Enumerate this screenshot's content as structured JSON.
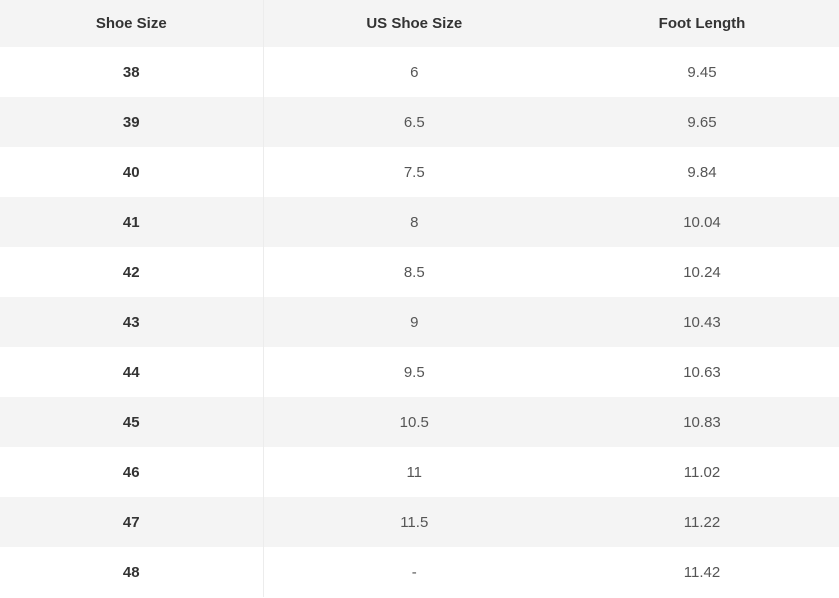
{
  "table": {
    "headers": [
      "Shoe Size",
      "US Shoe Size",
      "Foot Length"
    ],
    "rows": [
      [
        "38",
        "6",
        "9.45"
      ],
      [
        "39",
        "6.5",
        "9.65"
      ],
      [
        "40",
        "7.5",
        "9.84"
      ],
      [
        "41",
        "8",
        "10.04"
      ],
      [
        "42",
        "8.5",
        "10.24"
      ],
      [
        "43",
        "9",
        "10.43"
      ],
      [
        "44",
        "9.5",
        "10.63"
      ],
      [
        "45",
        "10.5",
        "10.83"
      ],
      [
        "46",
        "11",
        "11.02"
      ],
      [
        "47",
        "11.5",
        "11.22"
      ],
      [
        "48",
        "-",
        "11.42"
      ]
    ]
  },
  "colors": {
    "header_bg": "#f4f4f4",
    "stripe_bg": "#f4f4f4",
    "row_bg": "#ffffff",
    "text_strong": "#333333",
    "text_regular": "#555555"
  }
}
